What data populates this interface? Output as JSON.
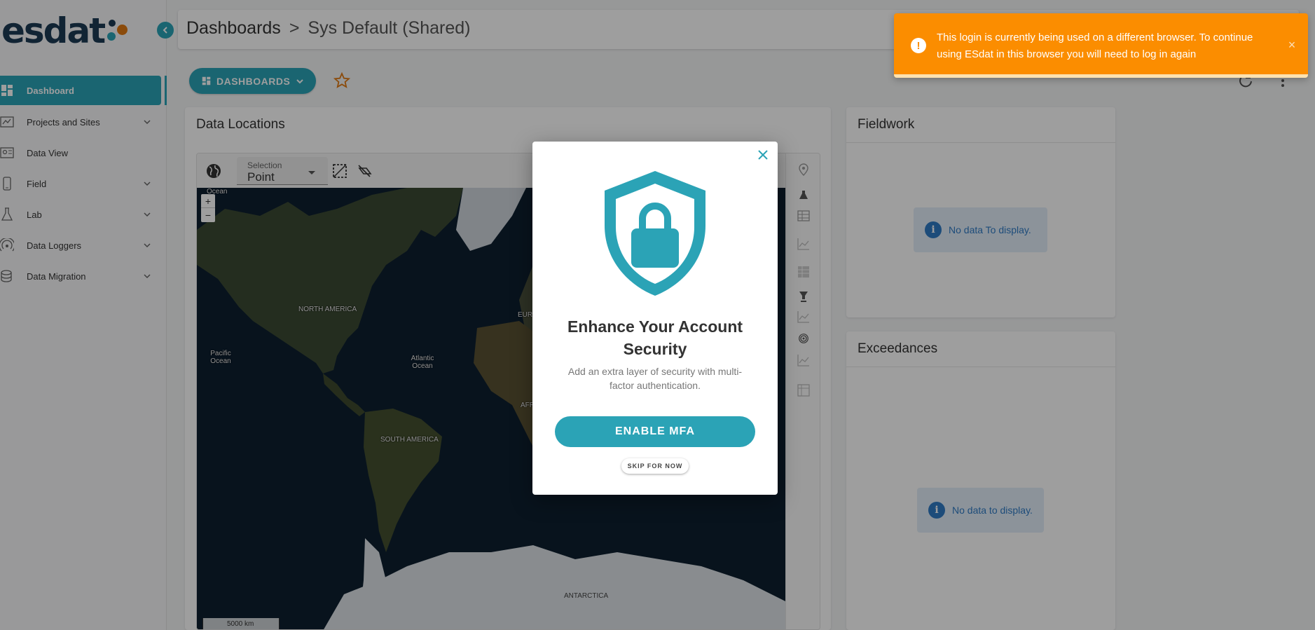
{
  "app": {
    "logo_text": "esdat",
    "brand_color": "#2ba3b6",
    "logo_dot_colors": [
      "#1c3a55",
      "#2ba3b6",
      "#e07a12"
    ]
  },
  "breadcrumb": {
    "root": "Dashboards",
    "separator": ">",
    "current": "Sys Default (Shared)"
  },
  "sidebar": {
    "items": [
      {
        "label": "Dashboard",
        "icon": "dashboard-icon",
        "active": true
      },
      {
        "label": "Projects and Sites",
        "icon": "projects-icon",
        "expandable": true
      },
      {
        "label": "Data View",
        "icon": "data-view-icon"
      },
      {
        "label": "Field",
        "icon": "field-device-icon",
        "expandable": true
      },
      {
        "label": "Lab",
        "icon": "flask-icon",
        "expandable": true
      },
      {
        "label": "Data Loggers",
        "icon": "signal-icon",
        "expandable": true
      },
      {
        "label": "Data Migration",
        "icon": "database-icon",
        "expandable": true
      }
    ]
  },
  "toolbar": {
    "dashboards_button": "DASHBOARDS"
  },
  "panels": {
    "data_locations": {
      "title": "Data Locations",
      "selection_label": "Selection",
      "selection_value": "Point",
      "zoom_in": "+",
      "zoom_out": "−",
      "scale_label": "5000 km",
      "map_labels": [
        {
          "text": "Ocean"
        },
        {
          "text": "NORTH AMERICA"
        },
        {
          "text": "Pacific Ocean"
        },
        {
          "text": "Atlantic Ocean"
        },
        {
          "text": "SOUTH AMERICA"
        },
        {
          "text": "EUR"
        },
        {
          "text": "AFR"
        },
        {
          "text": "ANTARCTICA"
        }
      ]
    },
    "fieldwork": {
      "title": "Fieldwork",
      "empty_message": "No data To display."
    },
    "exceedances": {
      "title": "Exceedances",
      "empty_message": "No data to display."
    }
  },
  "modal": {
    "title": "Enhance Your Account Security",
    "description": "Add an extra layer of security with multi-factor authentication.",
    "primary_button": "ENABLE MFA",
    "secondary_button": "SKIP FOR NOW"
  },
  "toast": {
    "message": "This login is currently being used on a different browser. To continue using ESdat in this browser you will need to log in again",
    "color": "#fb8d00",
    "close": "×",
    "icon": "!"
  }
}
